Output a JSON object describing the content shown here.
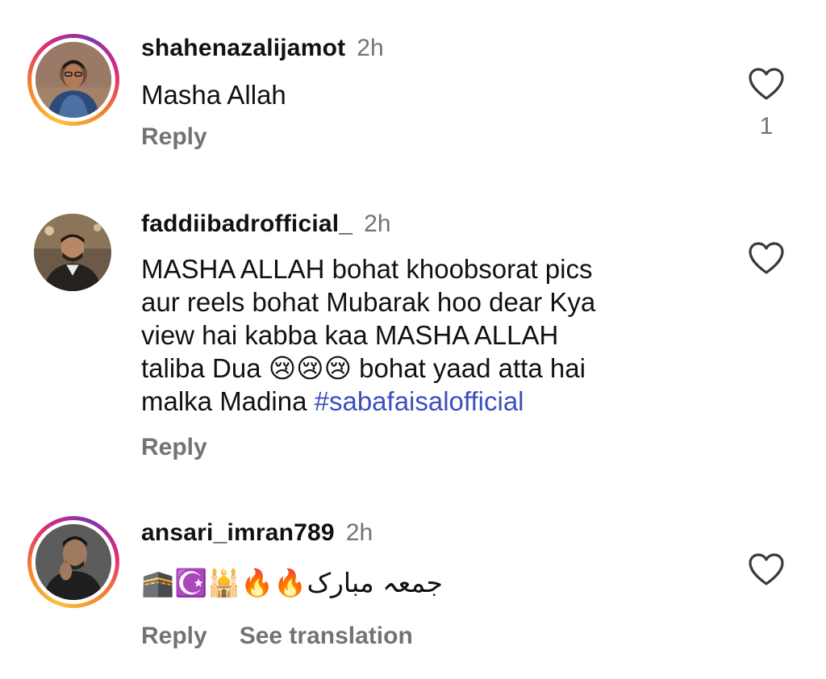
{
  "comments": [
    {
      "username": "shahenazalijamot",
      "time": "2h",
      "text": "Masha Allah",
      "reply_label": "Reply",
      "like_count": "1"
    },
    {
      "username": "faddiibadrofficial_",
      "time": "2h",
      "text_line1": "MASHA ALLAH bohat khoobsorat pics",
      "text_line2": "aur reels bohat Mubarak hoo dear Kya",
      "text_line3": "view hai kabba kaa MASHA ALLAH",
      "text_line4_a": "taliba Dua",
      "text_line4_emoji": "😢😢😢",
      "text_line4_b": "bohat yaad atta hai",
      "text_line5_a": "malka Madina",
      "hashtag": "#sabafaisalofficial",
      "reply_label": "Reply"
    },
    {
      "username": "ansari_imran789",
      "time": "2h",
      "emoji_prefix": "🕋☪️🕌🔥🔥",
      "arabic_text": "جمعہ مبارک",
      "reply_label": "Reply",
      "translate_label": "See translation"
    }
  ],
  "colors": {
    "text": "#111111",
    "muted": "#737373",
    "hashtag": "#3b4ec0"
  },
  "icons": {
    "like": "heart-outline-icon"
  }
}
